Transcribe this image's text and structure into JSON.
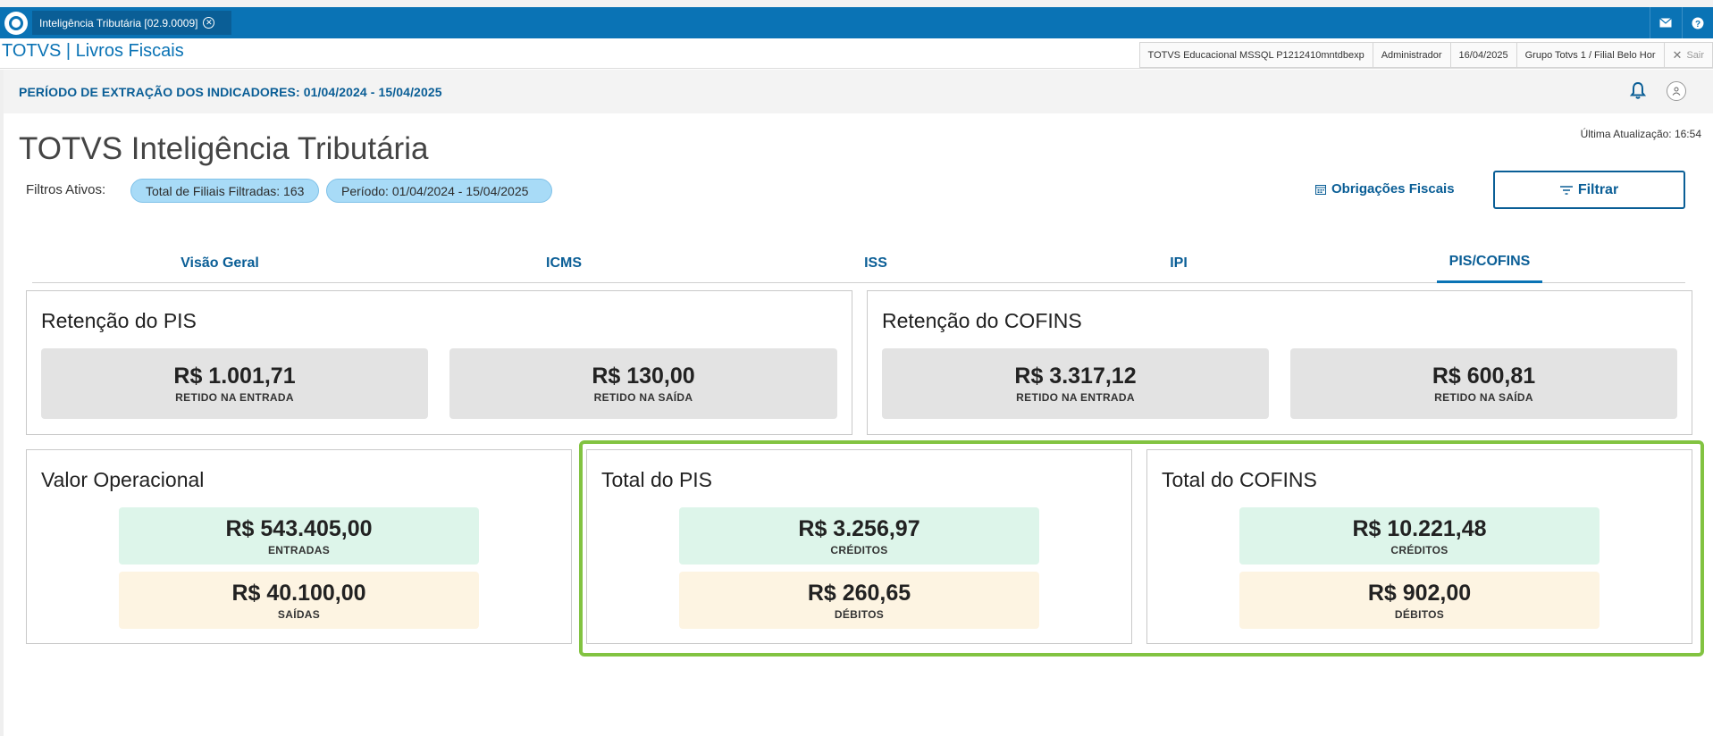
{
  "window": {
    "tab_title": "Inteligência Tributária [02.9.0009]",
    "tab_close_glyph": "✕"
  },
  "header": {
    "product_title": "TOTVS | Livros Fiscais",
    "environment": "TOTVS Educacional MSSQL P1212410mntdbexp",
    "user": "Administrador",
    "date": "16/04/2025",
    "branch": "Grupo Totvs 1 / Filial Belo Hor",
    "logout_label": "Sair"
  },
  "period_bar": {
    "text": "PERÍODO DE EXTRAÇÃO DOS INDICADORES: 01/04/2024 - 15/04/2025"
  },
  "page": {
    "title": "TOTVS Inteligência Tributária",
    "last_update": "Última Atualização: 16:54"
  },
  "filters": {
    "label": "Filtros Ativos:",
    "chips": [
      "Total de Filiais Filtradas: 163",
      "Período: 01/04/2024 - 15/04/2025"
    ],
    "obligations_link": "Obrigações Fiscais",
    "filter_button": "Filtrar"
  },
  "tabs": [
    {
      "label": "Visão Geral",
      "active": false
    },
    {
      "label": "ICMS",
      "active": false
    },
    {
      "label": "ISS",
      "active": false
    },
    {
      "label": "IPI",
      "active": false
    },
    {
      "label": "PIS/COFINS",
      "active": true
    }
  ],
  "cards": {
    "retencao_pis": {
      "title": "Retenção do PIS",
      "metrics": [
        {
          "value": "R$ 1.001,71",
          "label": "RETIDO NA ENTRADA"
        },
        {
          "value": "R$ 130,00",
          "label": "RETIDO NA SAÍDA"
        }
      ]
    },
    "retencao_cofins": {
      "title": "Retenção do COFINS",
      "metrics": [
        {
          "value": "R$ 3.317,12",
          "label": "RETIDO NA ENTRADA"
        },
        {
          "value": "R$ 600,81",
          "label": "RETIDO NA SAÍDA"
        }
      ]
    },
    "valor_operacional": {
      "title": "Valor Operacional",
      "metrics": [
        {
          "value": "R$ 543.405,00",
          "label": "ENTRADAS"
        },
        {
          "value": "R$ 40.100,00",
          "label": "SAÍDAS"
        }
      ]
    },
    "total_pis": {
      "title": "Total do PIS",
      "metrics": [
        {
          "value": "R$ 3.256,97",
          "label": "CRÉDITOS"
        },
        {
          "value": "R$ 260,65",
          "label": "DÉBITOS"
        }
      ]
    },
    "total_cofins": {
      "title": "Total do COFINS",
      "metrics": [
        {
          "value": "R$ 10.221,48",
          "label": "CRÉDITOS"
        },
        {
          "value": "R$ 902,00",
          "label": "DÉBITOS"
        }
      ]
    }
  },
  "colors": {
    "brand_blue": "#0a73b5",
    "dark_blue": "#0a5e96",
    "chip_bg": "#a8dbf7",
    "credit_bg": "#ddf5ea",
    "debit_bg": "#fdf4e2",
    "retention_bg": "#e3e3e3",
    "highlight": "#82c341"
  }
}
